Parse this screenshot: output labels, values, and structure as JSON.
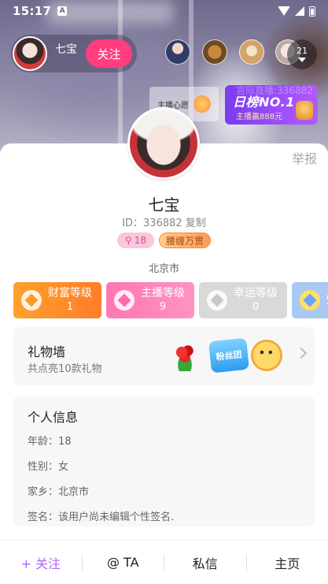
{
  "status_bar": {
    "time": "15:17",
    "notification_glyph": "A"
  },
  "live": {
    "host_name": "七宝",
    "follow_label": "关注",
    "viewer_count": "21",
    "wish_label": "主播心愿",
    "rank_title": "日榜NO.1",
    "rank_sub": "主播赢888元",
    "rank_ghost": "官际直播:336882"
  },
  "profile": {
    "report_label": "举报",
    "name": "七宝",
    "id_text": "ID：336882 复制",
    "fans_badge": "18",
    "vip_badge": "腰缠万贯",
    "location": "北京市"
  },
  "levels": [
    {
      "title": "财富等级",
      "value": "1"
    },
    {
      "title": "主播等级",
      "value": "9"
    },
    {
      "title": "幸运等级",
      "value": "0"
    },
    {
      "title": "魅",
      "value": ""
    }
  ],
  "gift_wall": {
    "title": "礼物墙",
    "subtitle": "共点亮10款礼物",
    "fans_gift_text": "粉丝团"
  },
  "info": {
    "title": "个人信息",
    "age": "年龄：18",
    "gender": "性别：女",
    "hometown": "家乡：北京市",
    "signature": "签名：该用户尚未编辑个性签名."
  },
  "bottom_bar": {
    "follow": "+ 关注",
    "at": "@ TA",
    "message": "私信",
    "home": "主页"
  },
  "colors": {
    "accent_pink": "#ff3d7f",
    "accent_purple": "#b266ff",
    "wealth_orange": "#ff8c2a",
    "host_pink": "#ff7fb8"
  }
}
